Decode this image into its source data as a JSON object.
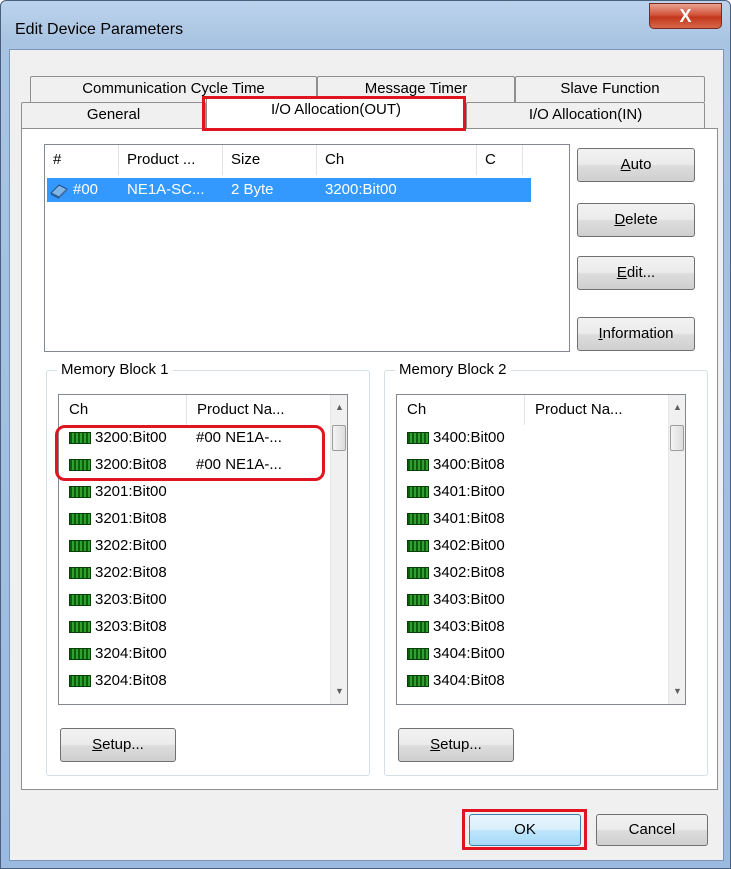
{
  "window": {
    "title": "Edit Device Parameters",
    "close_glyph": "X"
  },
  "tabs": {
    "row1": [
      "Communication Cycle Time",
      "Message Timer",
      "Slave Function"
    ],
    "row2": [
      "General",
      "I/O Allocation(OUT)",
      "I/O Allocation(IN)"
    ],
    "active": "I/O Allocation(OUT)"
  },
  "device_list": {
    "columns": [
      "#",
      "Product ...",
      "Size",
      "Ch",
      "C"
    ],
    "rows": [
      {
        "num": "#00",
        "product": "NE1A-SC...",
        "size": "2 Byte",
        "ch": "3200:Bit00",
        "icon": "device-icon"
      }
    ]
  },
  "side_buttons": {
    "auto": {
      "label": "Auto",
      "mnemonic": "A",
      "rest": "uto"
    },
    "delete": {
      "label": "Delete",
      "mnemonic": "D",
      "rest": "elete"
    },
    "edit": {
      "label": "Edit...",
      "mnemonic": "E",
      "rest": "dit..."
    },
    "information": {
      "label": "Information",
      "mnemonic": "I",
      "rest": "nformation"
    }
  },
  "memory_block_1": {
    "title": "Memory Block 1",
    "columns": [
      "Ch",
      "Product Na..."
    ],
    "rows": [
      {
        "ch": "3200:Bit00",
        "name": "#00 NE1A-..."
      },
      {
        "ch": "3200:Bit08",
        "name": "#00 NE1A-..."
      },
      {
        "ch": "3201:Bit00",
        "name": ""
      },
      {
        "ch": "3201:Bit08",
        "name": ""
      },
      {
        "ch": "3202:Bit00",
        "name": ""
      },
      {
        "ch": "3202:Bit08",
        "name": ""
      },
      {
        "ch": "3203:Bit00",
        "name": ""
      },
      {
        "ch": "3203:Bit08",
        "name": ""
      },
      {
        "ch": "3204:Bit00",
        "name": ""
      },
      {
        "ch": "3204:Bit08",
        "name": ""
      }
    ],
    "setup": {
      "label": "Setup...",
      "mnemonic": "S",
      "rest": "etup..."
    }
  },
  "memory_block_2": {
    "title": "Memory Block 2",
    "columns": [
      "Ch",
      "Product Na..."
    ],
    "rows": [
      {
        "ch": "3400:Bit00",
        "name": ""
      },
      {
        "ch": "3400:Bit08",
        "name": ""
      },
      {
        "ch": "3401:Bit00",
        "name": ""
      },
      {
        "ch": "3401:Bit08",
        "name": ""
      },
      {
        "ch": "3402:Bit00",
        "name": ""
      },
      {
        "ch": "3402:Bit08",
        "name": ""
      },
      {
        "ch": "3403:Bit00",
        "name": ""
      },
      {
        "ch": "3403:Bit08",
        "name": ""
      },
      {
        "ch": "3404:Bit00",
        "name": ""
      },
      {
        "ch": "3404:Bit08",
        "name": ""
      }
    ],
    "setup": {
      "label": "Setup...",
      "mnemonic": "S",
      "rest": "etup..."
    }
  },
  "footer": {
    "ok": "OK",
    "cancel": "Cancel"
  },
  "colors": {
    "highlight": "#e0151f",
    "selection": "#3399ff",
    "memory_icon": "#1f7a1f"
  }
}
